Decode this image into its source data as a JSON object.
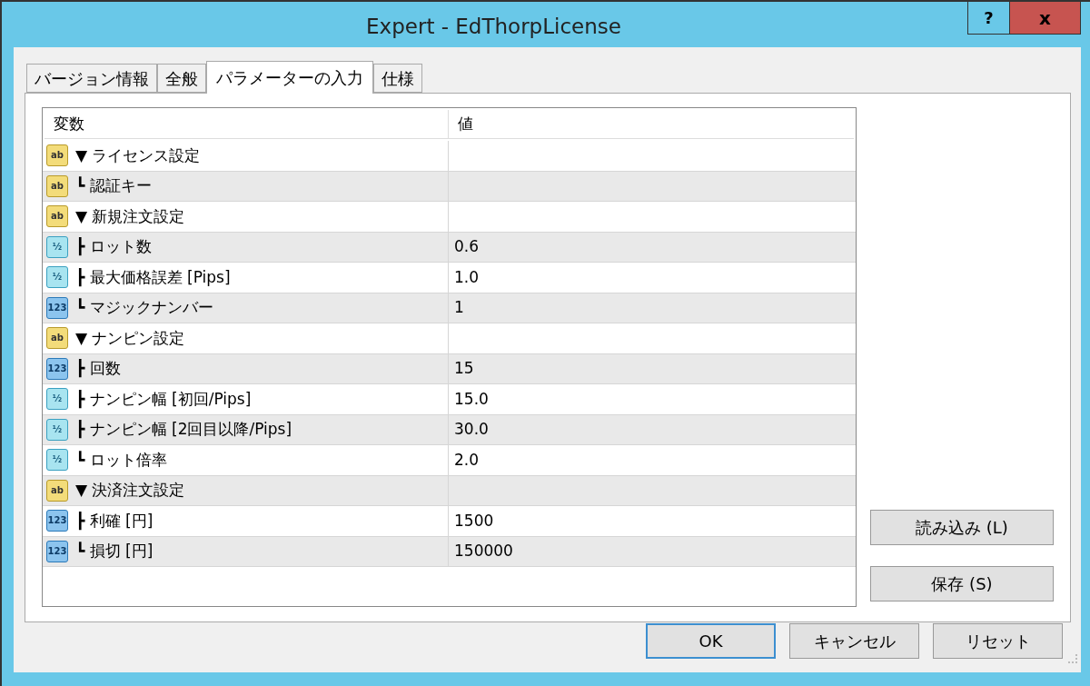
{
  "window": {
    "title": "Expert - EdThorpLicense",
    "help": "?",
    "close": "x"
  },
  "tabs": [
    {
      "label": "バージョン情報",
      "selected": false
    },
    {
      "label": "全般",
      "selected": false
    },
    {
      "label": "パラメーターの入力",
      "selected": true
    },
    {
      "label": "仕様",
      "selected": false
    }
  ],
  "table": {
    "columns": [
      "変数",
      "値"
    ],
    "rows": [
      {
        "kind": "string",
        "icon_text": "ab",
        "name": "▼ ライセンス設定",
        "value": ""
      },
      {
        "kind": "string",
        "icon_text": "ab",
        "name": "┗ 認証キー",
        "value": ""
      },
      {
        "kind": "string",
        "icon_text": "ab",
        "name": "▼ 新規注文設定",
        "value": ""
      },
      {
        "kind": "double",
        "icon_text": "½",
        "name": "┣ ロット数",
        "value": "0.6"
      },
      {
        "kind": "double",
        "icon_text": "½",
        "name": "┣ 最大価格誤差 [Pips]",
        "value": "1.0"
      },
      {
        "kind": "int",
        "icon_text": "123",
        "name": "┗ マジックナンバー",
        "value": "1"
      },
      {
        "kind": "string",
        "icon_text": "ab",
        "name": "▼ ナンピン設定",
        "value": ""
      },
      {
        "kind": "int",
        "icon_text": "123",
        "name": "┣ 回数",
        "value": "15"
      },
      {
        "kind": "double",
        "icon_text": "½",
        "name": "┣ ナンピン幅 [初回/Pips]",
        "value": "15.0"
      },
      {
        "kind": "double",
        "icon_text": "½",
        "name": "┣ ナンピン幅 [2回目以降/Pips]",
        "value": "30.0"
      },
      {
        "kind": "double",
        "icon_text": "½",
        "name": "┗ ロット倍率",
        "value": "2.0"
      },
      {
        "kind": "string",
        "icon_text": "ab",
        "name": "▼ 決済注文設定",
        "value": ""
      },
      {
        "kind": "int",
        "icon_text": "123",
        "name": "┣ 利確 [円]",
        "value": "1500"
      },
      {
        "kind": "int",
        "icon_text": "123",
        "name": "┗ 損切 [円]",
        "value": "150000"
      }
    ]
  },
  "side_buttons": [
    "読み込み (L)",
    "保存 (S)"
  ],
  "buttons": [
    {
      "label": "OK",
      "default": true
    },
    {
      "label": "キャンセル",
      "default": false
    },
    {
      "label": "リセット",
      "default": false
    }
  ]
}
